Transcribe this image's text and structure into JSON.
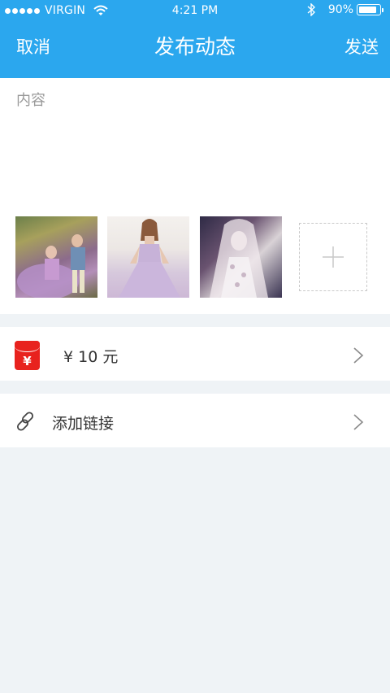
{
  "status_bar": {
    "carrier": "VIRGIN",
    "time": "4:21 PM",
    "battery_percent": "90%",
    "battery_level": 0.9,
    "signal_icon": "signal-dots-icon",
    "wifi_icon": "wifi-icon",
    "bluetooth_icon": "bluetooth-icon",
    "battery_icon": "battery-icon"
  },
  "nav": {
    "cancel_label": "取消",
    "title": "发布动态",
    "send_label": "发送"
  },
  "compose": {
    "placeholder": "内容",
    "value": "",
    "photos": [
      "photo-thumbnail",
      "photo-thumbnail",
      "photo-thumbnail"
    ],
    "add_icon": "plus-icon"
  },
  "red_packet": {
    "icon": "red-packet-icon",
    "icon_symbol": "¥",
    "amount_label": "¥ 10 元",
    "chevron_icon": "chevron-right-icon"
  },
  "link": {
    "icon": "link-icon",
    "label": "添加链接",
    "chevron_icon": "chevron-right-icon"
  },
  "colors": {
    "header": "#2ba7ee",
    "background": "#eff3f6",
    "red_packet": "#e8221e"
  }
}
